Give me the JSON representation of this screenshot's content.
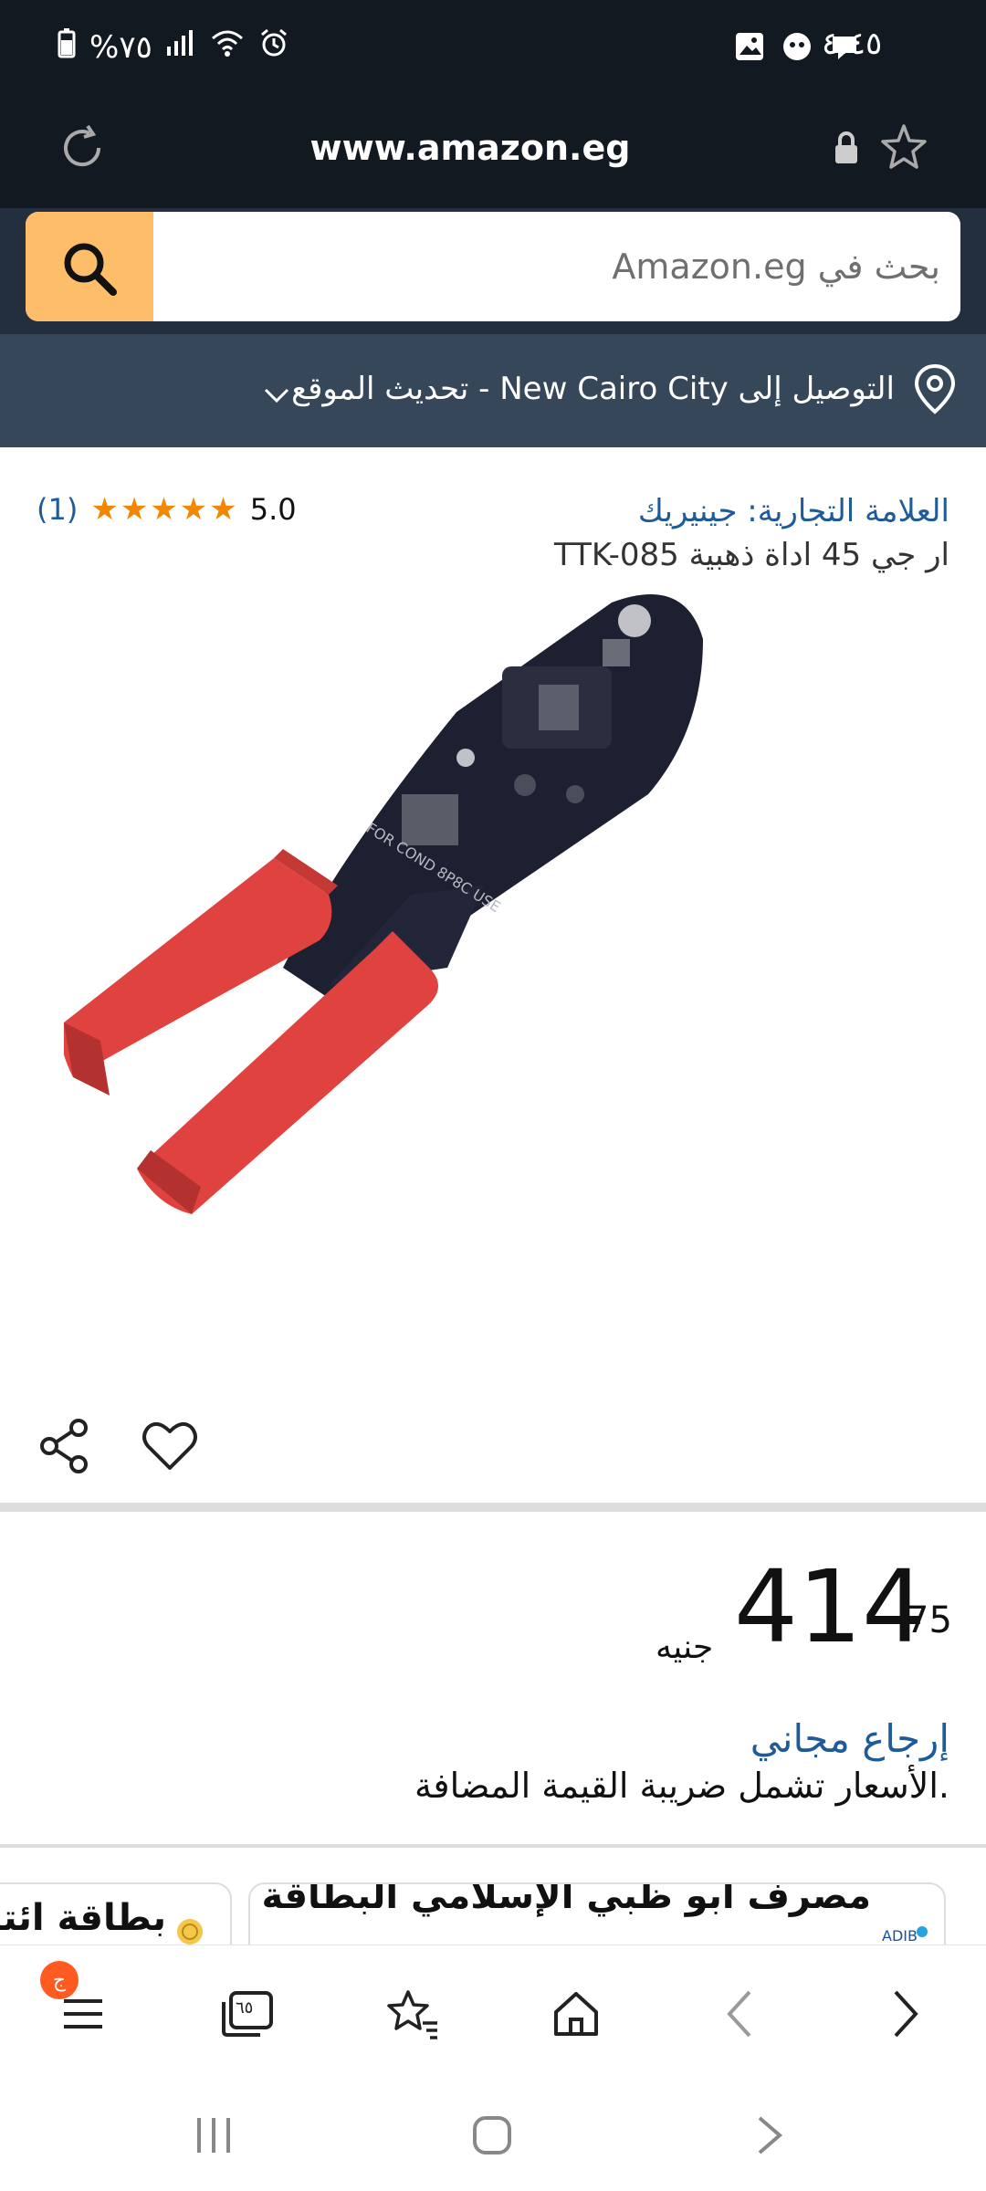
{
  "status_bar": {
    "time": "٤:٤٥",
    "battery": "%٧٥"
  },
  "browser": {
    "url": "www.amazon.eg"
  },
  "search": {
    "placeholder": "بحث في Amazon.eg"
  },
  "delivery": {
    "text": "التوصيل إلى New Cairo City - تحديث الموقع"
  },
  "product": {
    "brand": "العلامة التجارية: جينيريك",
    "title": "ار جي 45 اداة ذهبية TTK-085",
    "rating_value": "5.0",
    "rating_count": "(1)",
    "stars": 5,
    "image_text": "FOR COND 8P8C USE"
  },
  "price": {
    "whole": "414",
    "cents": "75",
    "currency": "جنيه"
  },
  "returns": "إرجاع مجاني",
  "vat_note": ".الأسعار تشمل ضريبة القيمة المضافة",
  "offers": [
    {
      "text": "مصرف أبو ظبي الإسلامي البطاقة المغطاة"
    },
    {
      "text": "بطاقة ائتمان"
    }
  ],
  "toolbar": {
    "tabs_count": "٦٥",
    "menu_badge": "ج"
  },
  "colors": {
    "header_dark": "#131921",
    "search_band": "#232f3e",
    "delivery_band": "#37475a",
    "search_button": "#febd69",
    "link": "#1f5b99",
    "star": "#f08804"
  }
}
